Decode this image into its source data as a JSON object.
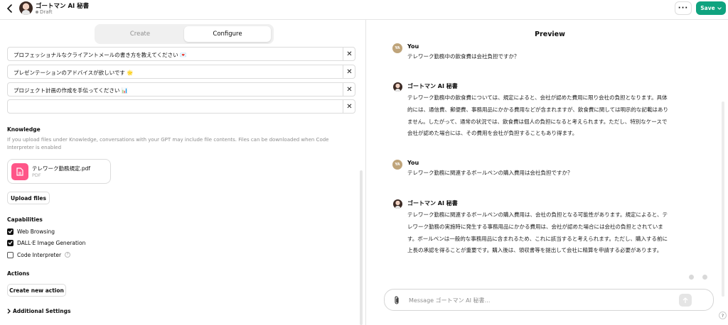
{
  "header": {
    "gpt_name": "ゴートマン AI 秘書",
    "status": "Draft",
    "more_label": "···",
    "save_label": "Save"
  },
  "tabs": [
    {
      "label": "Create",
      "active": false
    },
    {
      "label": "Configure",
      "active": true
    }
  ],
  "conversation_starters": [
    "プロフェッショナルなクライアントメールの書き方を教えてください 💌",
    "プレゼンテーションのアドバイスが欲しいです 🌟",
    "プロジェクト計画の作成を手伝ってください 📊",
    ""
  ],
  "remove_label": "✕",
  "knowledge": {
    "title": "Knowledge",
    "description": "If you upload files under Knowledge, conversations with your GPT may include file contents. Files can be downloaded when Code Interpreter is enabled",
    "file": {
      "name": "テレワーク勤務規定.pdf",
      "type": "PDF"
    },
    "upload_label": "Upload files"
  },
  "capabilities": {
    "title": "Capabilities",
    "items": [
      {
        "label": "Web Browsing",
        "checked": true
      },
      {
        "label": "DALL·E Image Generation",
        "checked": true
      },
      {
        "label": "Code Interpreter",
        "checked": false,
        "help": "?"
      }
    ]
  },
  "actions": {
    "title": "Actions",
    "create_label": "Create new action"
  },
  "advanced": {
    "label": "Additional Settings"
  },
  "preview": {
    "title": "Preview",
    "messages": [
      {
        "role": "user",
        "author": "You",
        "initials": "YA",
        "text": "テレワーク勤務中の飲食費は会社負担ですか？"
      },
      {
        "role": "assistant",
        "author": "ゴートマン AI 秘書",
        "text": "テレワーク勤務中の飲食費については、規定によると、会社が認めた費用に限り会社の負担となります。具体的には、通信費、郵便費、事務用品にかかる費用などが含まれますが、飲食費に関しては明示的な記載はありません。したがって、通常の状況では、飲食費は個人の負担になると考えられます。ただし、特別なケースで会社が認めた場合には、その費用を会社が負担することもあり得ます。"
      },
      {
        "role": "user",
        "author": "You",
        "initials": "YA",
        "text": "テレワーク勤務に関連するボールペンの購入費用は会社負担ですか？"
      },
      {
        "role": "assistant",
        "author": "ゴートマン AI 秘書",
        "text": "テレワーク勤務に関連するボールペンの購入費用は、会社の負担となる可能性があります。規定によると、テレワーク勤務の実施時に発生する事務用品にかかる費用は、会社が認めた場合には会社の負担とされています。ボールペンは一般的な事務用品に含まれるため、これに該当すると考えられます。ただし、購入する前に上長の承認を得ることが重要です。購入後は、領収書等を提出して会社に精算を申請する必要があります。"
      }
    ],
    "composer_placeholder": "Message ゴートマン AI 秘書…",
    "help_label": "?"
  }
}
